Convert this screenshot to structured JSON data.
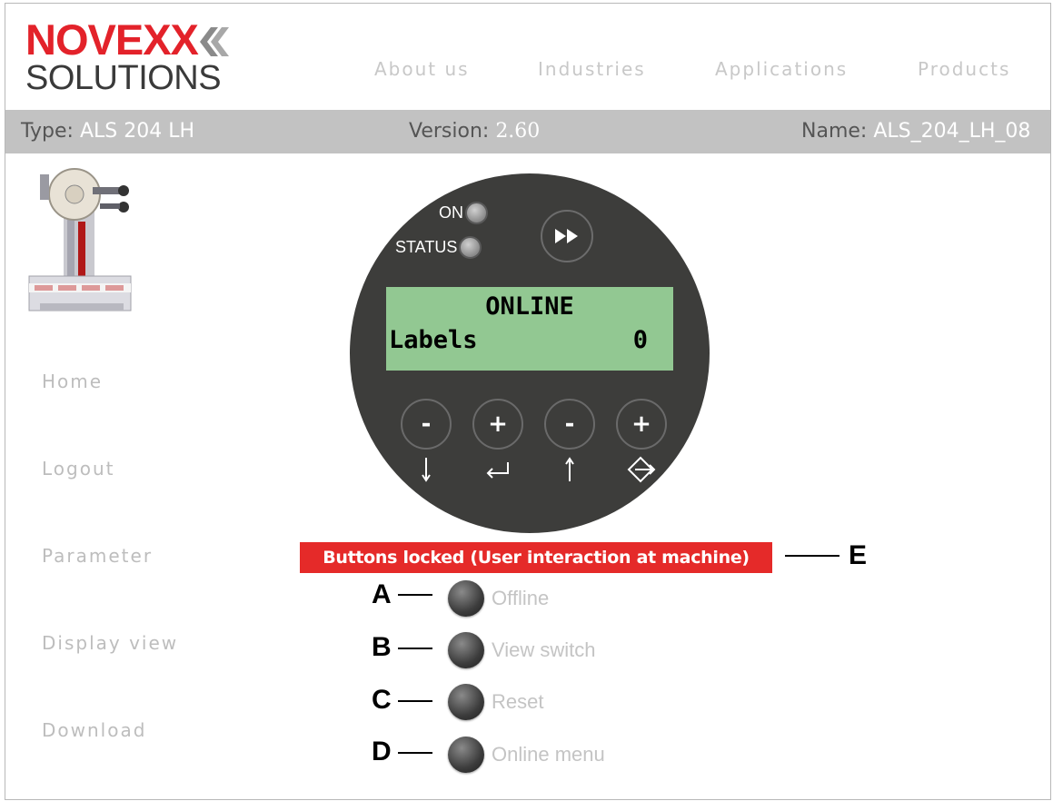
{
  "brand": {
    "word": "NOVEXX",
    "sub": "SOLUTIONS",
    "red": "#e3222a",
    "grey": "#3a3a3a"
  },
  "topnav": [
    "About us",
    "Industries",
    "Applications",
    "Products"
  ],
  "infobar": {
    "type_label": "Type:",
    "type_value": "ALS 204 LH",
    "version_label": "Version:",
    "version_value": "2.60",
    "name_label": "Name:",
    "name_value": "ALS_204_LH_08"
  },
  "sidenav": [
    "Home",
    "Logout",
    "Parameter",
    "Display view",
    "Download"
  ],
  "controller": {
    "led_on": "ON",
    "led_status": "STATUS",
    "fast_forward_icon": "fast-forward-icon",
    "lcd_line1": "ONLINE",
    "lcd_line2_label": "Labels",
    "lcd_line2_value": "0",
    "lcd_color": "#92c892",
    "keys": [
      {
        "sign": "-",
        "arrow": "arrow-down-icon"
      },
      {
        "sign": "+",
        "arrow": "enter-icon"
      },
      {
        "sign": "-",
        "arrow": "arrow-up-icon"
      },
      {
        "sign": "+",
        "arrow": "exit-icon"
      }
    ]
  },
  "locked_banner": {
    "text": "Buttons locked (User interaction at machine)",
    "color": "#e52a29"
  },
  "actions": [
    {
      "callout": "A",
      "label": "Offline"
    },
    {
      "callout": "B",
      "label": "View switch"
    },
    {
      "callout": "C",
      "label": "Reset"
    },
    {
      "callout": "D",
      "label": "Online menu"
    }
  ],
  "banner_callout": "E"
}
